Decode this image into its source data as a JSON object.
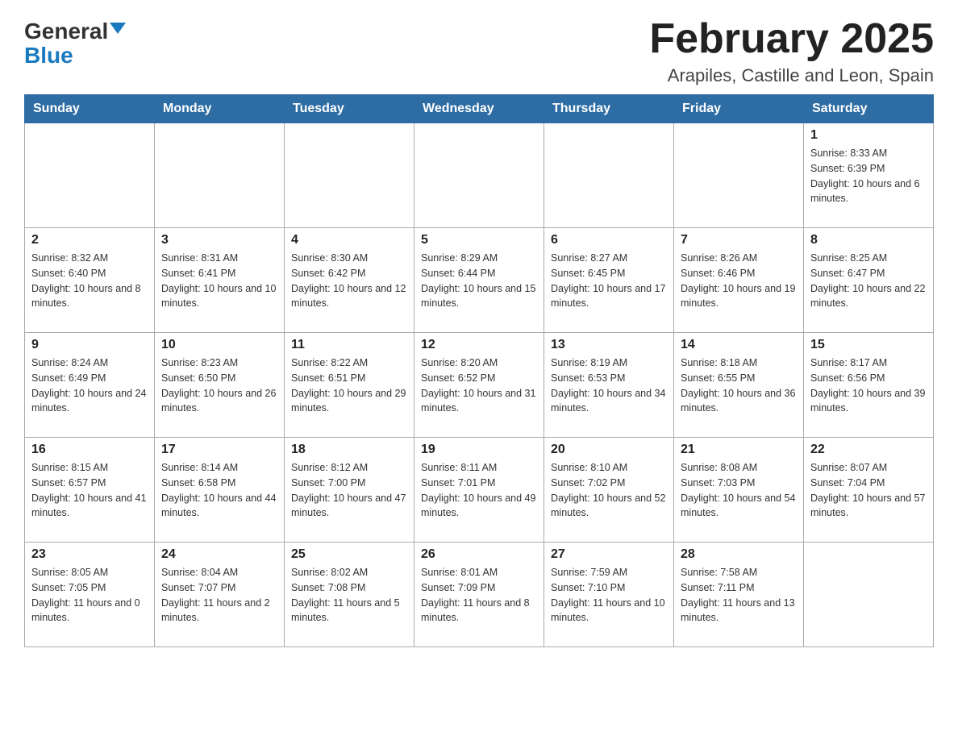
{
  "header": {
    "logo_general": "General",
    "logo_blue": "Blue",
    "title": "February 2025",
    "subtitle": "Arapiles, Castille and Leon, Spain"
  },
  "days_of_week": [
    "Sunday",
    "Monday",
    "Tuesday",
    "Wednesday",
    "Thursday",
    "Friday",
    "Saturday"
  ],
  "weeks": [
    [
      {
        "day": "",
        "sunrise": "",
        "sunset": "",
        "daylight": ""
      },
      {
        "day": "",
        "sunrise": "",
        "sunset": "",
        "daylight": ""
      },
      {
        "day": "",
        "sunrise": "",
        "sunset": "",
        "daylight": ""
      },
      {
        "day": "",
        "sunrise": "",
        "sunset": "",
        "daylight": ""
      },
      {
        "day": "",
        "sunrise": "",
        "sunset": "",
        "daylight": ""
      },
      {
        "day": "",
        "sunrise": "",
        "sunset": "",
        "daylight": ""
      },
      {
        "day": "1",
        "sunrise": "Sunrise: 8:33 AM",
        "sunset": "Sunset: 6:39 PM",
        "daylight": "Daylight: 10 hours and 6 minutes."
      }
    ],
    [
      {
        "day": "2",
        "sunrise": "Sunrise: 8:32 AM",
        "sunset": "Sunset: 6:40 PM",
        "daylight": "Daylight: 10 hours and 8 minutes."
      },
      {
        "day": "3",
        "sunrise": "Sunrise: 8:31 AM",
        "sunset": "Sunset: 6:41 PM",
        "daylight": "Daylight: 10 hours and 10 minutes."
      },
      {
        "day": "4",
        "sunrise": "Sunrise: 8:30 AM",
        "sunset": "Sunset: 6:42 PM",
        "daylight": "Daylight: 10 hours and 12 minutes."
      },
      {
        "day": "5",
        "sunrise": "Sunrise: 8:29 AM",
        "sunset": "Sunset: 6:44 PM",
        "daylight": "Daylight: 10 hours and 15 minutes."
      },
      {
        "day": "6",
        "sunrise": "Sunrise: 8:27 AM",
        "sunset": "Sunset: 6:45 PM",
        "daylight": "Daylight: 10 hours and 17 minutes."
      },
      {
        "day": "7",
        "sunrise": "Sunrise: 8:26 AM",
        "sunset": "Sunset: 6:46 PM",
        "daylight": "Daylight: 10 hours and 19 minutes."
      },
      {
        "day": "8",
        "sunrise": "Sunrise: 8:25 AM",
        "sunset": "Sunset: 6:47 PM",
        "daylight": "Daylight: 10 hours and 22 minutes."
      }
    ],
    [
      {
        "day": "9",
        "sunrise": "Sunrise: 8:24 AM",
        "sunset": "Sunset: 6:49 PM",
        "daylight": "Daylight: 10 hours and 24 minutes."
      },
      {
        "day": "10",
        "sunrise": "Sunrise: 8:23 AM",
        "sunset": "Sunset: 6:50 PM",
        "daylight": "Daylight: 10 hours and 26 minutes."
      },
      {
        "day": "11",
        "sunrise": "Sunrise: 8:22 AM",
        "sunset": "Sunset: 6:51 PM",
        "daylight": "Daylight: 10 hours and 29 minutes."
      },
      {
        "day": "12",
        "sunrise": "Sunrise: 8:20 AM",
        "sunset": "Sunset: 6:52 PM",
        "daylight": "Daylight: 10 hours and 31 minutes."
      },
      {
        "day": "13",
        "sunrise": "Sunrise: 8:19 AM",
        "sunset": "Sunset: 6:53 PM",
        "daylight": "Daylight: 10 hours and 34 minutes."
      },
      {
        "day": "14",
        "sunrise": "Sunrise: 8:18 AM",
        "sunset": "Sunset: 6:55 PM",
        "daylight": "Daylight: 10 hours and 36 minutes."
      },
      {
        "day": "15",
        "sunrise": "Sunrise: 8:17 AM",
        "sunset": "Sunset: 6:56 PM",
        "daylight": "Daylight: 10 hours and 39 minutes."
      }
    ],
    [
      {
        "day": "16",
        "sunrise": "Sunrise: 8:15 AM",
        "sunset": "Sunset: 6:57 PM",
        "daylight": "Daylight: 10 hours and 41 minutes."
      },
      {
        "day": "17",
        "sunrise": "Sunrise: 8:14 AM",
        "sunset": "Sunset: 6:58 PM",
        "daylight": "Daylight: 10 hours and 44 minutes."
      },
      {
        "day": "18",
        "sunrise": "Sunrise: 8:12 AM",
        "sunset": "Sunset: 7:00 PM",
        "daylight": "Daylight: 10 hours and 47 minutes."
      },
      {
        "day": "19",
        "sunrise": "Sunrise: 8:11 AM",
        "sunset": "Sunset: 7:01 PM",
        "daylight": "Daylight: 10 hours and 49 minutes."
      },
      {
        "day": "20",
        "sunrise": "Sunrise: 8:10 AM",
        "sunset": "Sunset: 7:02 PM",
        "daylight": "Daylight: 10 hours and 52 minutes."
      },
      {
        "day": "21",
        "sunrise": "Sunrise: 8:08 AM",
        "sunset": "Sunset: 7:03 PM",
        "daylight": "Daylight: 10 hours and 54 minutes."
      },
      {
        "day": "22",
        "sunrise": "Sunrise: 8:07 AM",
        "sunset": "Sunset: 7:04 PM",
        "daylight": "Daylight: 10 hours and 57 minutes."
      }
    ],
    [
      {
        "day": "23",
        "sunrise": "Sunrise: 8:05 AM",
        "sunset": "Sunset: 7:05 PM",
        "daylight": "Daylight: 11 hours and 0 minutes."
      },
      {
        "day": "24",
        "sunrise": "Sunrise: 8:04 AM",
        "sunset": "Sunset: 7:07 PM",
        "daylight": "Daylight: 11 hours and 2 minutes."
      },
      {
        "day": "25",
        "sunrise": "Sunrise: 8:02 AM",
        "sunset": "Sunset: 7:08 PM",
        "daylight": "Daylight: 11 hours and 5 minutes."
      },
      {
        "day": "26",
        "sunrise": "Sunrise: 8:01 AM",
        "sunset": "Sunset: 7:09 PM",
        "daylight": "Daylight: 11 hours and 8 minutes."
      },
      {
        "day": "27",
        "sunrise": "Sunrise: 7:59 AM",
        "sunset": "Sunset: 7:10 PM",
        "daylight": "Daylight: 11 hours and 10 minutes."
      },
      {
        "day": "28",
        "sunrise": "Sunrise: 7:58 AM",
        "sunset": "Sunset: 7:11 PM",
        "daylight": "Daylight: 11 hours and 13 minutes."
      },
      {
        "day": "",
        "sunrise": "",
        "sunset": "",
        "daylight": ""
      }
    ]
  ]
}
